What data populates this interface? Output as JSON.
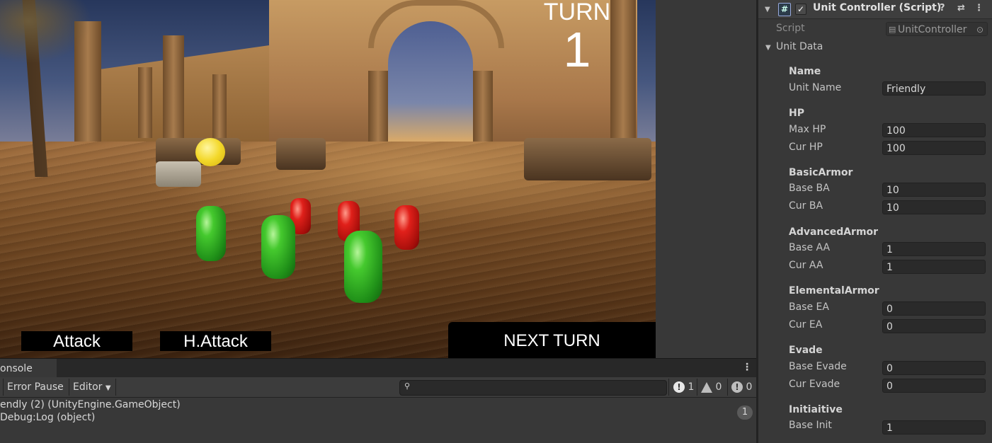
{
  "game": {
    "turn_label": "TURN",
    "turn_number": "1",
    "buttons": {
      "attack": "Attack",
      "heavy_attack": "H.Attack",
      "next_turn": "NEXT TURN"
    }
  },
  "console": {
    "tab_label": "onsole",
    "toolbar": {
      "error_pause": "Error Pause",
      "editor": "Editor",
      "counts": {
        "info": "1",
        "warnings": "0",
        "errors": "0"
      }
    },
    "log": {
      "line1": "endly (2) (UnityEngine.GameObject)",
      "line2": "Debug:Log (object)",
      "count": "1"
    }
  },
  "inspector": {
    "component_title": "Unit Controller (Script)",
    "script_label": "Script",
    "script_value": "UnitController",
    "unit_data_label": "Unit Data",
    "sections": {
      "name": "Name",
      "hp": "HP",
      "basic_armor": "BasicArmor",
      "advanced_armor": "AdvancedArmor",
      "elemental_armor": "ElementalArmor",
      "evade": "Evade",
      "initiative": "Initiaitive"
    },
    "fields": {
      "unit_name": {
        "label": "Unit Name",
        "value": "Friendly"
      },
      "max_hp": {
        "label": "Max HP",
        "value": "100"
      },
      "cur_hp": {
        "label": "Cur HP",
        "value": "100"
      },
      "base_ba": {
        "label": "Base BA",
        "value": "10"
      },
      "cur_ba": {
        "label": "Cur BA",
        "value": "10"
      },
      "base_aa": {
        "label": "Base AA",
        "value": "1"
      },
      "cur_aa": {
        "label": "Cur AA",
        "value": "1"
      },
      "base_ea": {
        "label": "Base EA",
        "value": "0"
      },
      "cur_ea": {
        "label": "Cur EA",
        "value": "0"
      },
      "base_evade": {
        "label": "Base Evade",
        "value": "0"
      },
      "cur_evade": {
        "label": "Cur Evade",
        "value": "0"
      },
      "base_init": {
        "label": "Base Init",
        "value": "1"
      }
    }
  }
}
